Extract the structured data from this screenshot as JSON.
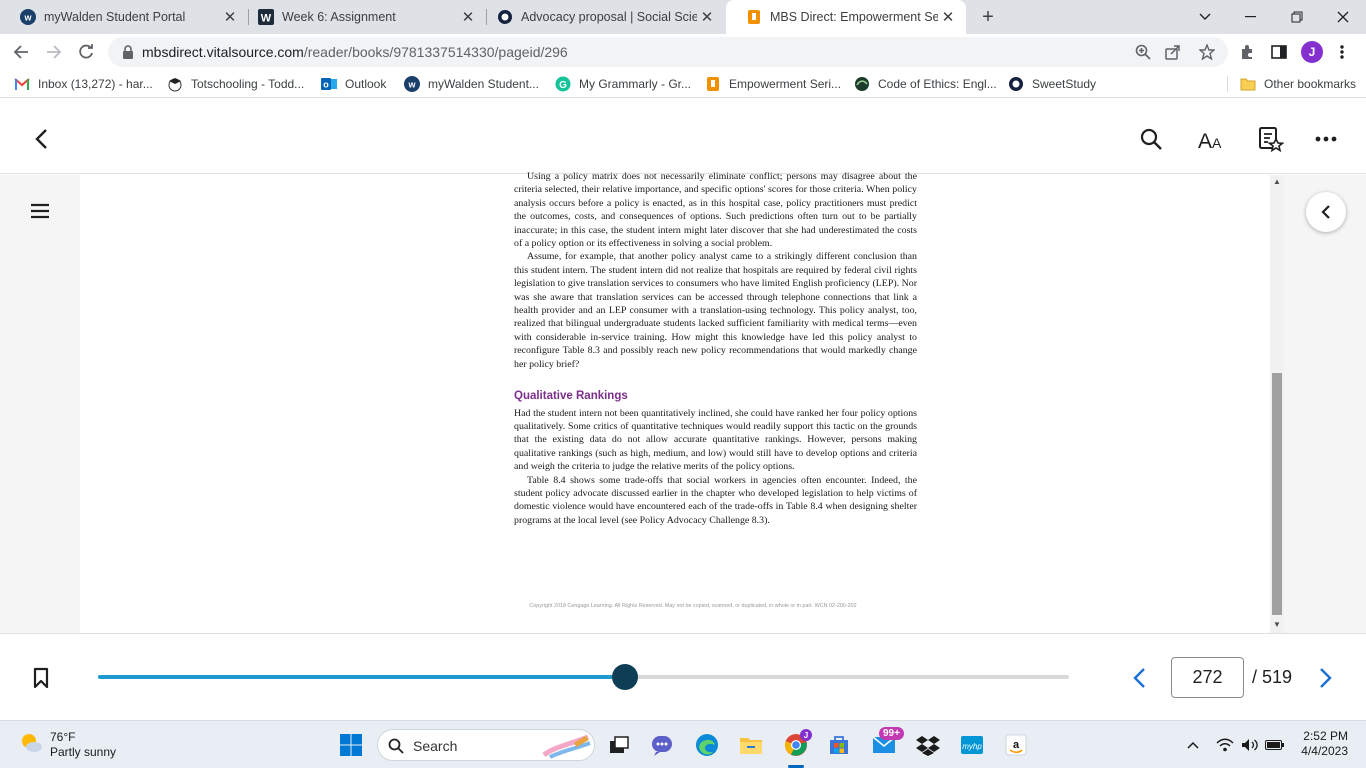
{
  "browser": {
    "tabs": [
      {
        "title": "myWalden Student Portal",
        "icon": "walden-icon",
        "active": false
      },
      {
        "title": "Week 6: Assignment",
        "icon": "walden-w-icon",
        "active": false
      },
      {
        "title": "Advocacy proposal | Social Scienc",
        "icon": "sweetstudy-icon",
        "active": false
      },
      {
        "title": "MBS Direct: Empowerment Series",
        "icon": "mbs-icon",
        "active": true
      }
    ],
    "address": {
      "domain": "mbsdirect.vitalsource.com",
      "path": "/reader/books/9781337514330/pageid/296"
    },
    "profile_initial": "J",
    "bookmarks": [
      {
        "label": "Inbox (13,272) - har...",
        "icon": "gmail-icon"
      },
      {
        "label": "Totschooling - Todd...",
        "icon": "totschooling-icon"
      },
      {
        "label": "Outlook",
        "icon": "outlook-icon"
      },
      {
        "label": "myWalden Student...",
        "icon": "walden-icon"
      },
      {
        "label": "My Grammarly - Gr...",
        "icon": "grammarly-icon"
      },
      {
        "label": "Empowerment Seri...",
        "icon": "mbs-icon"
      },
      {
        "label": "Code of Ethics: Engl...",
        "icon": "nasw-icon"
      },
      {
        "label": "SweetStudy",
        "icon": "sweetstudy-icon"
      }
    ],
    "other_bookmarks": "Other bookmarks"
  },
  "book": {
    "paragraphs_top": [
      "Using a policy matrix does not necessarily eliminate conflict; persons may disagree about the criteria selected, their relative importance, and specific options' scores for those criteria. When policy analysis occurs before a policy is enacted, as in this hospital case, policy practitioners must predict the outcomes, costs, and consequences of options. Such predictions often turn out to be partially inaccurate; in this case, the student intern might later discover that she had underestimated the costs of a policy option or its effectiveness in solving a social problem.",
      "Assume, for example, that another policy analyst came to a strikingly different conclusion than this student intern. The student intern did not realize that hospitals are required by federal civil rights legislation to give translation services to consumers who have limited English proficiency (LEP). Nor was she aware that translation services can be accessed through telephone connections that link a health provider and an LEP consumer with a translation-using technology. This policy analyst, too, realized that bilingual undergraduate students lacked sufficient familiarity with medical terms—even with considerable in-service training. How might this knowledge have led this policy analyst to reconfigure Table 8.3 and possibly reach new policy recommendations that would markedly change her policy brief?"
    ],
    "section_heading": "Qualitative Rankings",
    "paragraphs_bottom": [
      "Had the student intern not been quantitatively inclined, she could have ranked her four policy options qualitatively. Some critics of quantitative techniques would readily support this tactic on the grounds that the existing data do not allow accurate quantitative rankings. However, persons making qualitative rankings (such as high, medium, and low) would still have to develop options and criteria and weigh the criteria to judge the relative merits of the policy options.",
      "Table 8.4 shows some trade-offs that social workers in agencies often encounter. Indeed, the student policy advocate discussed earlier in the chapter who developed legislation to help victims of domestic violence would have encountered each of the trade-offs in Table 8.4 when designing shelter programs at the local level (see Policy Advocacy Challenge 8.3)."
    ],
    "copyright": "Copyright 2018 Cengage Learning. All Rights Reserved. May not be copied, scanned, or duplicated, in whole or in part.  WCN 02-200-202"
  },
  "reader": {
    "current_page": "272",
    "total_pages": "/ 519",
    "progress_fraction": 0.543
  },
  "taskbar": {
    "temperature": "76°F",
    "weather": "Partly sunny",
    "search_label": "Search",
    "mail_badge": "99+",
    "time": "2:52 PM",
    "date": "4/4/2023"
  },
  "colors": {
    "accent": "#1d9bd1",
    "knob": "#0e3e55",
    "heading": "#7b2f8b"
  }
}
